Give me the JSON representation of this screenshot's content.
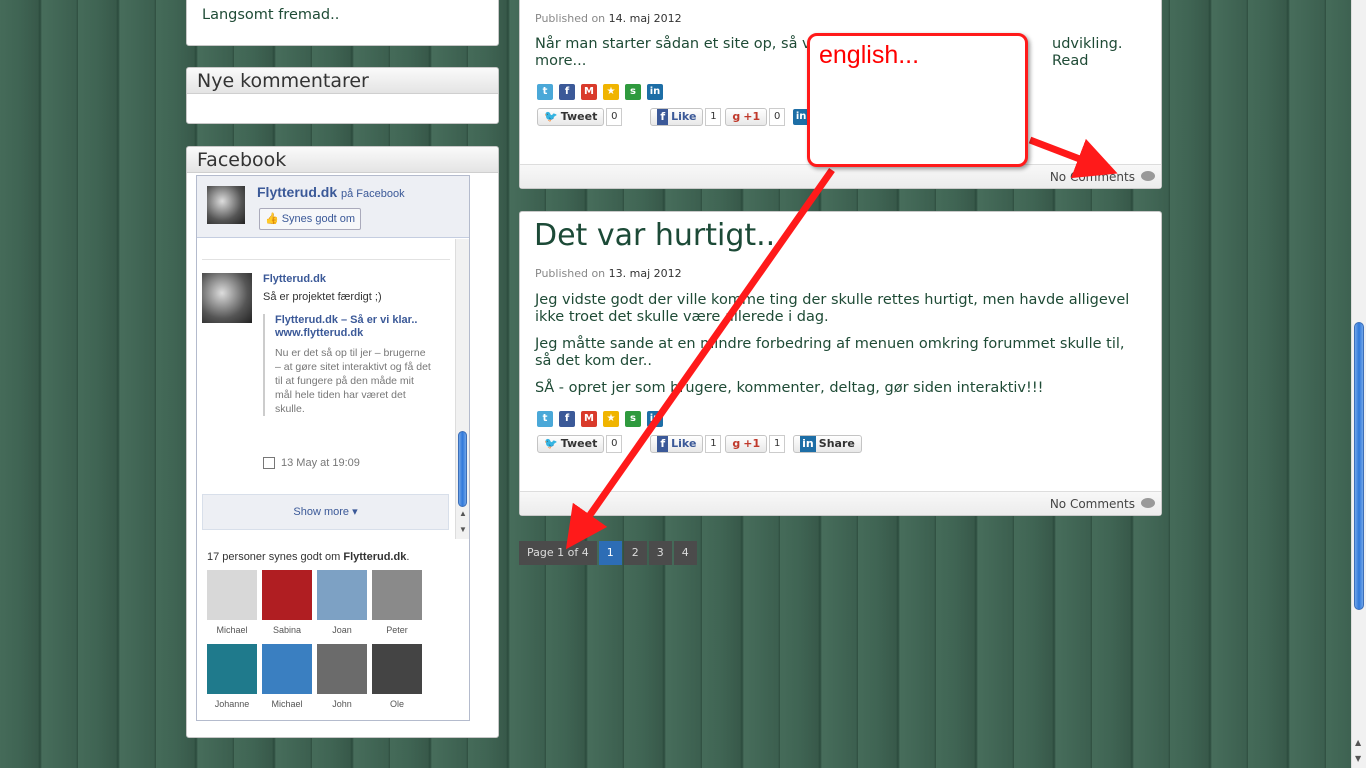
{
  "sidebar": {
    "top_widget": {
      "item": "Langsomt fremad.."
    },
    "comments_widget": {
      "title": "Nye kommentarer"
    },
    "facebook_widget": {
      "title": "Facebook",
      "page_name": "Flytterud.dk",
      "on_facebook": "på Facebook",
      "like_button": "Synes godt om",
      "post_author": "Flytterud.dk",
      "post_text": "Så er projektet færdigt ;)",
      "link_title": "Flytterud.dk – Så er vi klar..",
      "link_url": "www.flytterud.dk",
      "link_desc": "Nu er det så op til jer – brugerne – at gøre sitet interaktivt og få det til at fungere på den måde mit mål hele tiden har været det skulle.",
      "post_time": "13 May at 19:09",
      "show_more": "Show more",
      "fans_prefix": "17 personer synes godt om",
      "fans_page": "Flytterud.dk",
      "fans_suffix": ".",
      "fans": [
        "Michael",
        "Sabina",
        "Joan",
        "Peter",
        "Johanne",
        "Michael",
        "John",
        "Ole"
      ],
      "fan_colors": [
        "#d8d8d8",
        "#b01e22",
        "#7da1c4",
        "#8a8a8a",
        "#1f7a8c",
        "#3a7fc1",
        "#6b6b6b",
        "#444444"
      ]
    }
  },
  "posts": [
    {
      "published_label": "Published on",
      "date": "14. maj 2012",
      "excerpt_a": "Når man starter sådan et site op, så vil d",
      "excerpt_b": "udvikling. Read",
      "excerpt_c": "more...",
      "tweet": "Tweet",
      "tweet_count": "0",
      "like": "Like",
      "like_count": "1",
      "plus": "+1",
      "plus_count": "0",
      "comments": "No Comments"
    },
    {
      "title": "Det var hurtigt..",
      "published_label": "Published on",
      "date": "13. maj 2012",
      "p1": "Jeg vidste godt der ville komme ting der skulle rettes hurtigt, men havde alligevel ikke troet det skulle være allerede i dag.",
      "p2": "Jeg måtte sande at en mindre forbedring af menuen omkring forummet skulle til, så det kom der..",
      "p3": "SÅ - opret jer som brugere, kommenter, deltag, gør siden interaktiv!!!",
      "tweet": "Tweet",
      "tweet_count": "0",
      "like": "Like",
      "like_count": "1",
      "plus": "+1",
      "plus_count": "1",
      "share": "Share",
      "comments": "No Comments"
    }
  ],
  "pagination": {
    "label": "Page 1 of 4",
    "pages": [
      "1",
      "2",
      "3",
      "4"
    ],
    "active": "1"
  },
  "annotation": {
    "text": "english...",
    "color": "#ff0000"
  }
}
